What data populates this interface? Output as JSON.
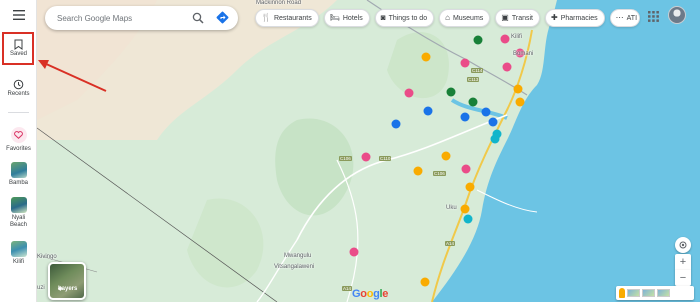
{
  "rail": {
    "menu_icon": "hamburger-icon",
    "saved_label": "Saved",
    "recents_label": "Recents",
    "favorites_label": "Favorites",
    "places": [
      {
        "label": "Bamba"
      },
      {
        "label": "Nyali Beach"
      },
      {
        "label": "Kilifi"
      }
    ]
  },
  "search": {
    "placeholder": "Search Google Maps",
    "search_icon": "search-icon",
    "directions_icon": "directions-icon"
  },
  "chips": [
    {
      "label": "Restaurants",
      "icon": "restaurant-icon"
    },
    {
      "label": "Hotels",
      "icon": "hotel-icon"
    },
    {
      "label": "Things to do",
      "icon": "camera-icon"
    },
    {
      "label": "Museums",
      "icon": "museum-icon"
    },
    {
      "label": "Transit",
      "icon": "transit-icon"
    },
    {
      "label": "Pharmacies",
      "icon": "pharmacy-icon"
    },
    {
      "label": "ATI",
      "icon": "more-icon"
    }
  ],
  "map": {
    "place_labels": [
      "Mackinnon Road",
      "Kilifi",
      "Bomani",
      "Uku",
      "Mwangulu",
      "Vitsangalaweni",
      "Kivingo",
      "uzi"
    ],
    "road_labels": [
      "C114",
      "C113",
      "C110",
      "C106",
      "C106",
      "A14",
      "A14"
    ],
    "layers_label": "Layers",
    "logo_text": "Google"
  },
  "colors": {
    "water": "#6cc4e4",
    "land": "#d7ebd8",
    "arid": "#f4ede0",
    "road": "#ffffff",
    "highlight": "#d93025"
  }
}
